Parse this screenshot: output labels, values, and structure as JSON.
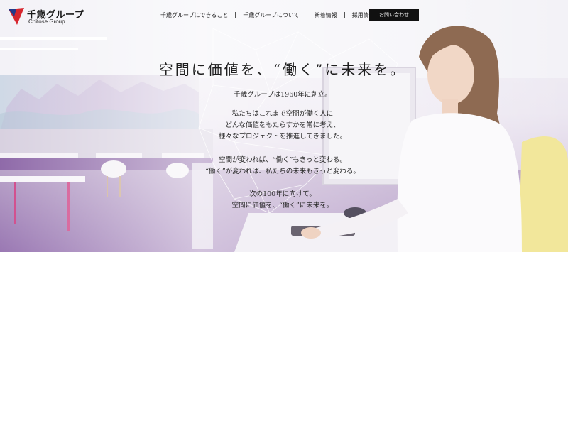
{
  "brand": {
    "name_ja": "千歳グループ",
    "name_en": "Chitose Group",
    "mark_color": "#d7262e",
    "mark_accent": "#243a8a"
  },
  "nav": {
    "items": [
      {
        "label": "千歳グループにできること"
      },
      {
        "label": "千歳グループについて"
      },
      {
        "label": "新着情報"
      },
      {
        "label": "採用情報"
      }
    ],
    "contact_label": "お問い合わせ"
  },
  "hero": {
    "headline": "空間に価値を、“働く”に未来を。",
    "paragraphs": [
      [
        "千歳グループは1960年に創立。"
      ],
      [
        "私たちはこれまで空間が働く人に",
        "どんな価値をもたらすかを常に考え、",
        "様々なプロジェクトを推進してきました。"
      ],
      [
        "空間が変われば、“働く”もきっと変わる。",
        "“働く”が変われば、私たちの未来もきっと変わる。"
      ],
      [
        "次の100年に向けて。",
        "空間に価値を、“働く”に未来を。"
      ]
    ]
  }
}
